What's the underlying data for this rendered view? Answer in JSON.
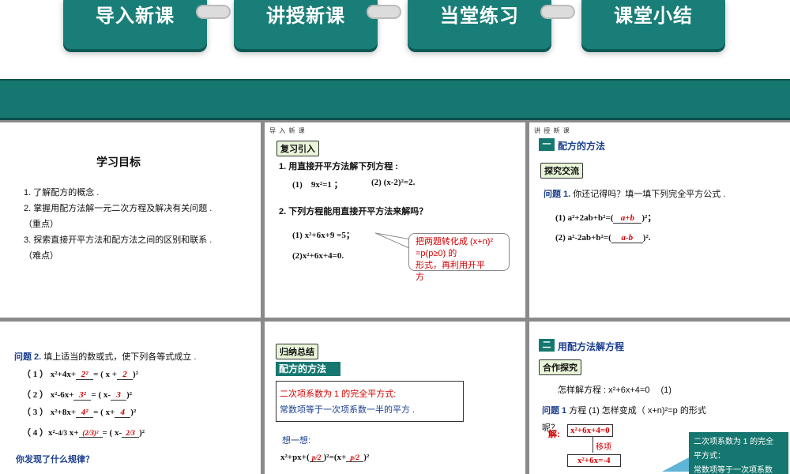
{
  "nav": {
    "tabs": [
      {
        "label": "导入新课"
      },
      {
        "label": "讲授新课"
      },
      {
        "label": "当堂练习"
      },
      {
        "label": "课堂小结"
      }
    ]
  },
  "colors": {
    "accent": "#157770",
    "red": "#d40000",
    "blue": "#1b3f8f"
  },
  "slide1": {
    "title": "学习目标",
    "goals": [
      "1. 了解配方的概念 .",
      "2. 掌握用配方法解一元二次方程及解决有关问题 .",
      "（重点）",
      "3. 探索直接开平方法和配方法之间的区别和联系 .",
      "（难点）"
    ]
  },
  "slide2": {
    "header": "导 入 新 课",
    "tag": "复习引入",
    "q1": "1. 用直接开平方法解下列方程 :",
    "q1a": "(1)　9x²=1 ；",
    "q1b": "(2)  (x-2)²=2.",
    "q2": "2. 下列方程能用直接开平方法来解吗？",
    "q2a": "(1) x²+6x+9 =5；",
    "q2b": "(2)x²+6x+4=0.",
    "callout": [
      "把两题转化成 (x+n)²",
      "=p(p≥0) 的",
      "形式，再利用开平",
      "方"
    ]
  },
  "slide3": {
    "header": "讲 授 新 课",
    "section_no": "一",
    "section_title": "配方的方法",
    "tag": "探究交流",
    "question_label": "问题 1.",
    "question": "你还记得吗？填一填下列完全平方公式 .",
    "f1_pre": "(1)  a²+2ab+b²=(",
    "f1_ans": "a+b",
    "f1_post": ")²；",
    "f2_pre": "(2)  a²-2ab+b²=(",
    "f2_ans": "a-b",
    "f2_post": ")²."
  },
  "slide4": {
    "question_label": "问题 2.",
    "question": "填上适当的数或式，使下列各等式成立 .",
    "rows": [
      {
        "pre": "（ 1 ）  x²+4x+",
        "a1": "2²",
        "mid": "= ( x +",
        "a2": "2",
        "post": ")²"
      },
      {
        "pre": "（ 2 ）  x²-6x+",
        "a1": "3²",
        "mid": "= ( x-",
        "a2": "3",
        "post": ")²"
      },
      {
        "pre": "（ 3 ）  x²+8x+",
        "a1": "4²",
        "mid": "= ( x+",
        "a2": "4",
        "post": ")²"
      },
      {
        "pre": "（ 4 ）x²-",
        "frac1": "4/3",
        "x": "x+",
        "a1": "(2/3)²",
        "mid": "= ( x-",
        "a2": "2/3",
        "post": ")²"
      }
    ],
    "footer": "你发现了什么规律？"
  },
  "slide5": {
    "tag": "归纳总结",
    "title_bar": "配方的方法",
    "box_line1": "二次项系数为 1 的完全平方式:",
    "box_line2": "常数项等于一次项系数一半的平方 .",
    "think": "想一想:",
    "formula_pre": "x²+px+(",
    "formula_mid": ")²=(x+",
    "formula_post": ")²",
    "frac": "p/2"
  },
  "slide6": {
    "section_no": "二",
    "section_title": "用配方法解方程",
    "tag": "合作探究",
    "intro": "怎样解方程 : x²+6x+4=0　 (1)",
    "question_label": "问题 1",
    "question": "方程 (1) 怎样变成（ x+n)²=p 的形式",
    "question_cont": "呢？",
    "solve_label": "解:",
    "step1": "x²+6x+4=0",
    "step1_note": "移项",
    "step2": "x²+6x=-4",
    "callout": [
      "二次项系数为 1 的完全",
      "平方式：",
      "常数项等于一次项系数"
    ]
  }
}
